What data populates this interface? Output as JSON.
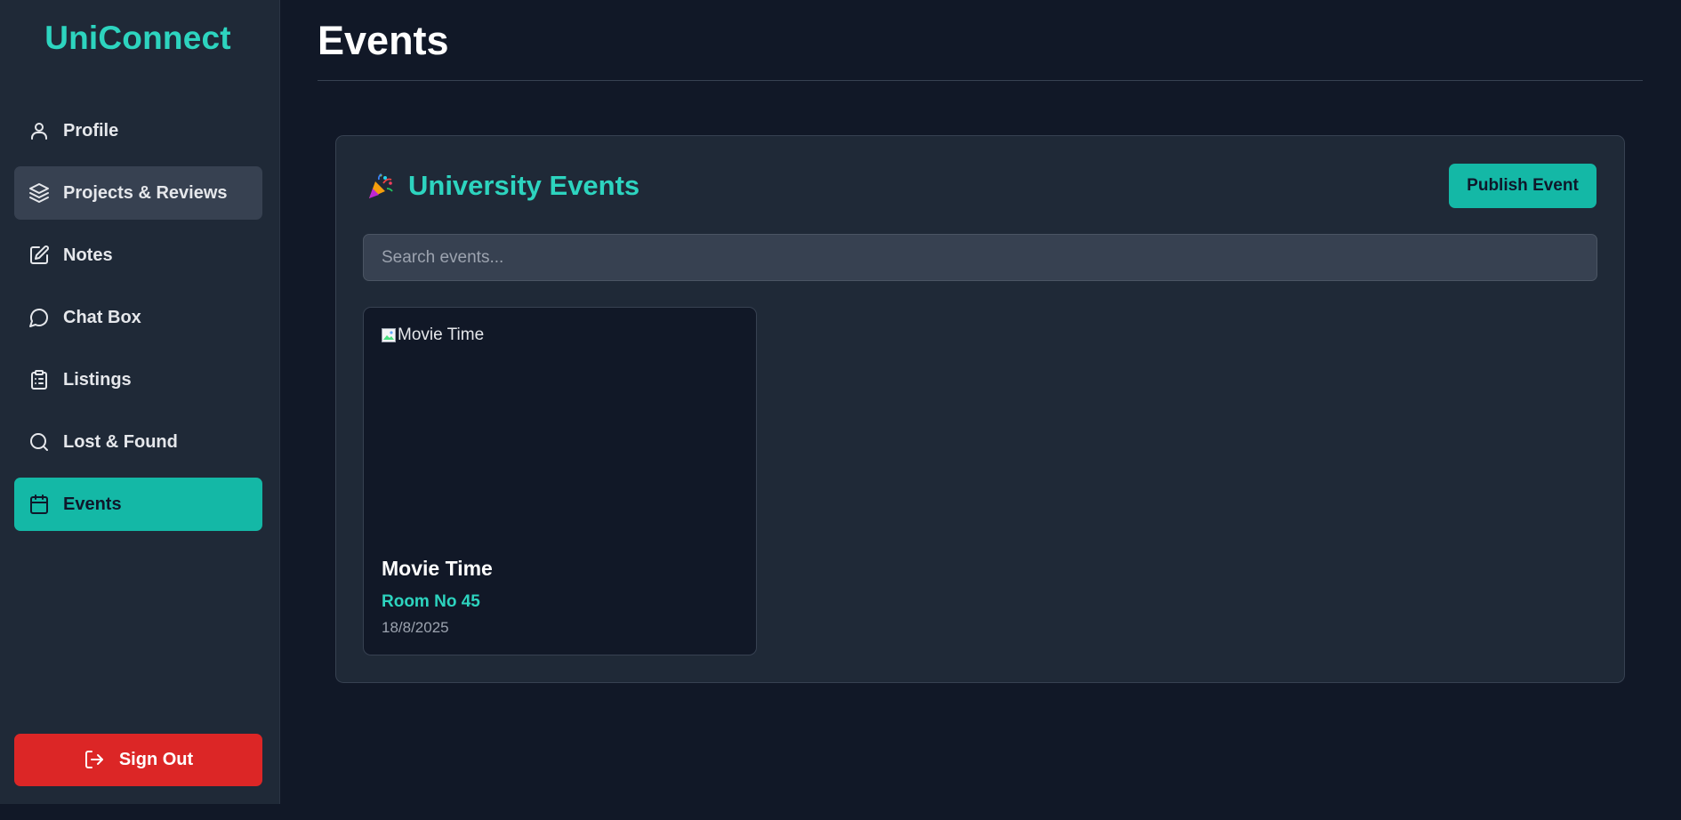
{
  "app": {
    "brand": "UniConnect"
  },
  "sidebar": {
    "items": [
      {
        "label": "Profile",
        "icon": "user-icon",
        "state": "default"
      },
      {
        "label": "Projects & Reviews",
        "icon": "layers-icon",
        "state": "hovered"
      },
      {
        "label": "Notes",
        "icon": "edit-icon",
        "state": "default"
      },
      {
        "label": "Chat Box",
        "icon": "chat-bubble-icon",
        "state": "default"
      },
      {
        "label": "Listings",
        "icon": "clipboard-list-icon",
        "state": "default"
      },
      {
        "label": "Lost & Found",
        "icon": "search-icon",
        "state": "default"
      },
      {
        "label": "Events",
        "icon": "calendar-icon",
        "state": "active"
      }
    ],
    "sign_out_label": "Sign Out",
    "sign_out_icon": "logout-icon"
  },
  "header": {
    "title": "Events"
  },
  "events": {
    "heading": "University Events",
    "heading_icon": "party-popper-icon",
    "publish_label": "Publish Event",
    "search": {
      "placeholder": "Search events...",
      "value": ""
    },
    "cards": [
      {
        "image_alt": "Movie Time",
        "title": "Movie Time",
        "location": "Room No 45",
        "date": "18/8/2025"
      }
    ]
  },
  "colors": {
    "background": "#111827",
    "sidebar": "#1f2937",
    "accent": "#14b8a6",
    "accent_text": "#2dd4bf",
    "danger": "#dc2626",
    "hover": "#374151"
  }
}
